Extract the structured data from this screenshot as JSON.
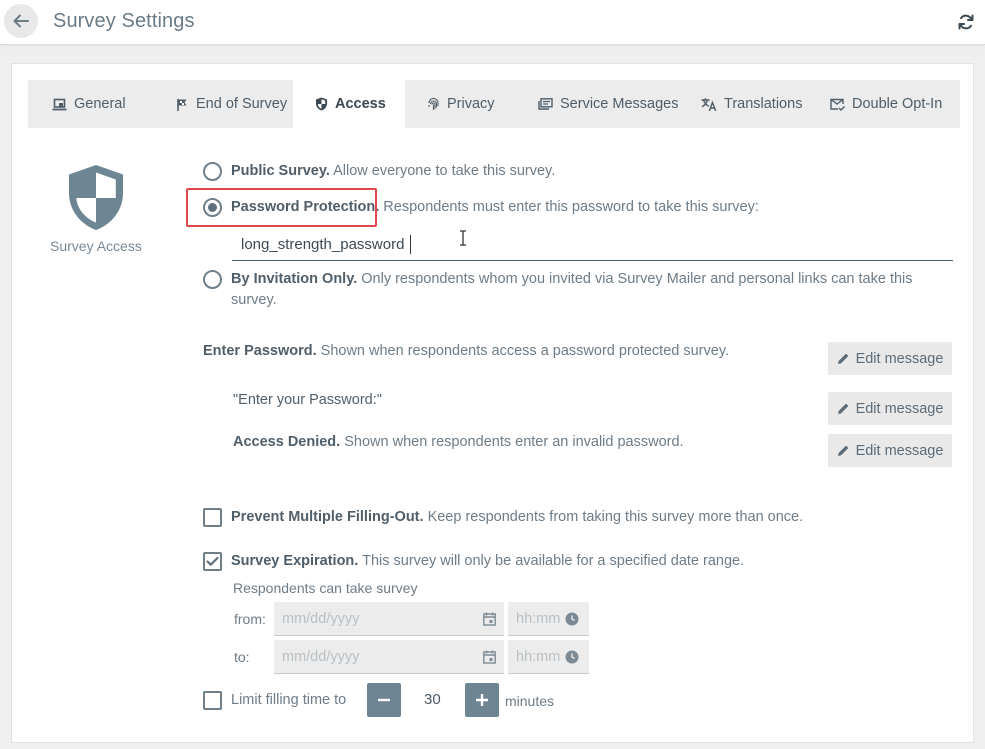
{
  "header": {
    "title": "Survey Settings",
    "back_icon": "arrow-left-icon",
    "refresh_icon": "refresh-icon"
  },
  "tabs": [
    {
      "label": "General",
      "icon": "laptop-icon",
      "active": false
    },
    {
      "label": "End of Survey",
      "icon": "flag-icon",
      "active": false
    },
    {
      "label": "Access",
      "icon": "shield-icon",
      "active": true
    },
    {
      "label": "Privacy",
      "icon": "fingerprint-icon",
      "active": false
    },
    {
      "label": "Service Messages",
      "icon": "message-icon",
      "active": false
    },
    {
      "label": "Translations",
      "icon": "translate-icon",
      "active": false
    },
    {
      "label": "Double Opt-In",
      "icon": "mail-check-icon",
      "active": false
    }
  ],
  "side": {
    "label": "Survey Access",
    "icon": "shield-icon"
  },
  "access": {
    "public": {
      "title": "Public Survey.",
      "desc": "Allow everyone to take this survey."
    },
    "password": {
      "title": "Password Protection.",
      "desc": "Respondents must enter this password to take this survey:",
      "value": "long_strength_password"
    },
    "invitation": {
      "title": "By Invitation Only.",
      "desc_line1": "Only respondents whom you invited via Survey Mailer and personal links can take this",
      "desc_line2": "survey."
    },
    "selected": "password"
  },
  "messages": {
    "enter_password": {
      "title": "Enter Password.",
      "desc": "Shown when respondents access a password protected survey."
    },
    "enter_your_password": "\"Enter your Password:\"",
    "access_denied": {
      "title": "Access Denied.",
      "desc": "Shown when respondents enter an invalid password."
    },
    "edit_label": "Edit message"
  },
  "prevent_multiple": {
    "title": "Prevent Multiple Filling-Out.",
    "desc": "Keep respondents from taking this survey more than once.",
    "checked": false
  },
  "expiration": {
    "title": "Survey Expiration.",
    "desc": "This survey will only be available for a specified date range.",
    "checked": true,
    "subtitle": "Respondents can take survey",
    "from_label": "from:",
    "to_label": "to:",
    "date_placeholder": "mm/dd/yyyy",
    "time_placeholder": "hh:mm"
  },
  "limit": {
    "label": "Limit filling time to",
    "value": "30",
    "unit": "minutes",
    "checked": false
  },
  "colors": {
    "accent": "#6e8593",
    "highlight": "#e0474c",
    "text": "#5b6b78"
  }
}
